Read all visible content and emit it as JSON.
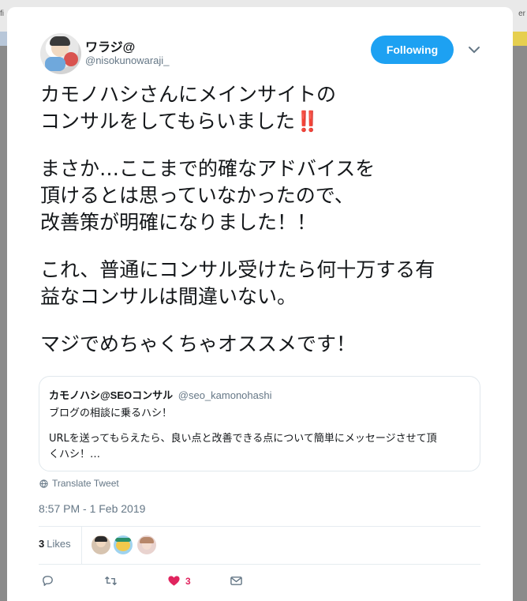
{
  "background": {
    "left_text": "fi",
    "right_text": "er"
  },
  "tweet": {
    "display_name": "ワラジ@",
    "handle": "@nisokunowaraji_",
    "follow_label": "Following",
    "text_lines": [
      "カモノハシさんにメインサイトの",
      "コンサルをしてもらいました",
      "",
      "まさか…ここまで的確なアドバイスを",
      "頂けるとは思っていなかったので、",
      "改善策が明確になりました！！",
      "",
      "これ、普通にコンサル受けたら何十万する有",
      "益なコンサルは間違いない。",
      "",
      "マジでめちゃくちゃオススメです！"
    ],
    "emoji": "‼️",
    "quote": {
      "name": "カモノハシ@SEOコンサル",
      "handle": "@seo_kamonohashi",
      "lines": [
        "ブログの相談に乗るハシ！",
        "",
        "URLを送ってもらえたら、良い点と改善できる点について簡単にメッセージさせて頂",
        "くハシ！…"
      ]
    },
    "translate_label": "Translate Tweet",
    "timestamp": "8:57 PM - 1 Feb 2019",
    "likes_count": "3",
    "likes_label": "Likes",
    "like_action_count": "3"
  },
  "colors": {
    "accent": "#1da1f2",
    "like": "#e0245e",
    "secondary_text": "#657786"
  },
  "icons": {
    "reply": "reply-icon",
    "retweet": "retweet-icon",
    "like": "heart-icon",
    "dm": "envelope-icon",
    "more": "chevron-down-icon",
    "translate": "globe-icon"
  }
}
